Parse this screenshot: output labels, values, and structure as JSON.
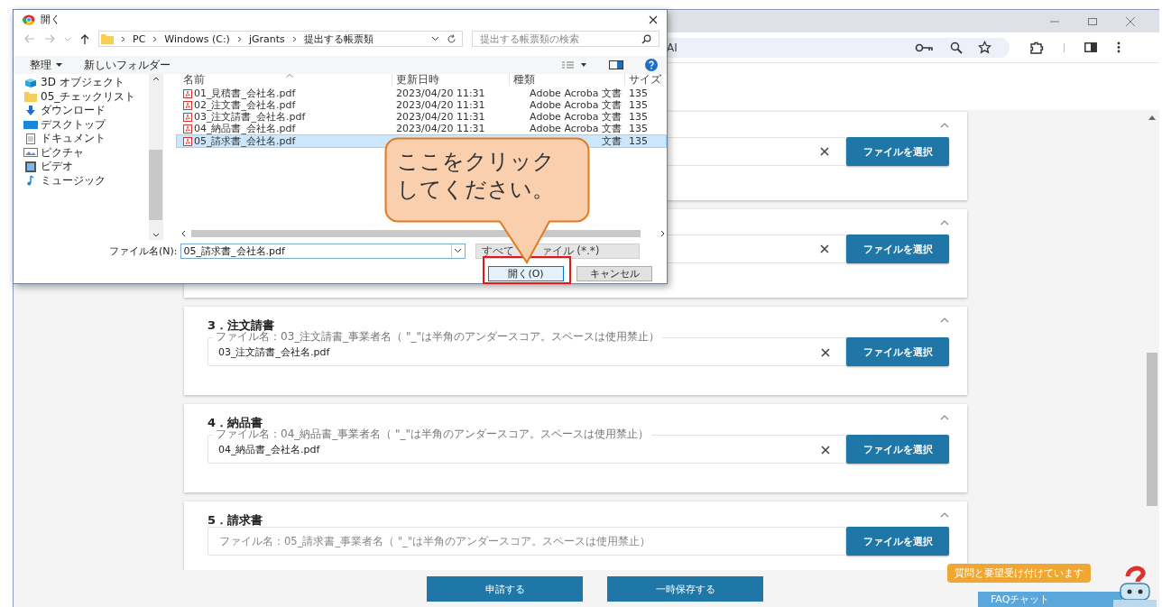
{
  "browser": {
    "address_text": "AI"
  },
  "cards": [
    {
      "expanded": true,
      "filled": true,
      "button": "ファイルを選択"
    },
    {
      "expanded": true,
      "filled": true,
      "button": "ファイルを選択"
    },
    {
      "title": "3．注文請書",
      "expanded": true,
      "filled": true,
      "legend": "ファイル名：03_注文請書_事業者名（ \"_\"は半角のアンダースコア。スペースは使用禁止）",
      "value": "03_注文請書_会社名.pdf",
      "button": "ファイルを選択"
    },
    {
      "title": "4．納品書",
      "expanded": true,
      "filled": true,
      "legend": "ファイル名：04_納品書_事業者名（ \"_\"は半角のアンダースコア。スペースは使用禁止）",
      "value": "04_納品書_会社名.pdf",
      "button": "ファイルを選択"
    },
    {
      "title": "5．請求書",
      "expanded": true,
      "filled": false,
      "placeholder": "ファイル名：05_請求書_事業者名（ \"_\"は半角のアンダースコア。スペースは使用禁止）",
      "button": "ファイルを選択"
    }
  ],
  "footer_buttons": [
    "申請する",
    "一時保存する"
  ],
  "faq": {
    "tooltip": "質問と要望受け付けています",
    "label": "FAQチャット"
  },
  "dialog": {
    "title": "開く",
    "breadcrumb": [
      "PC",
      "Windows (C:)",
      "jGrants",
      "提出する帳票類"
    ],
    "search": {
      "placeholder": "提出する帳票類の検索"
    },
    "commands": [
      "整理",
      "新しいフォルダー"
    ],
    "tree": [
      {
        "label": "3D オブジェクト",
        "kind": "cube"
      },
      {
        "label": "05_チェックリスト",
        "kind": "folder"
      },
      {
        "label": "ダウンロード",
        "kind": "download"
      },
      {
        "label": "デスクトップ",
        "kind": "desktop"
      },
      {
        "label": "ドキュメント",
        "kind": "document"
      },
      {
        "label": "ピクチャ",
        "kind": "picture"
      },
      {
        "label": "ビデオ",
        "kind": "video"
      },
      {
        "label": "ミュージック",
        "kind": "music"
      }
    ],
    "columns": [
      "名前",
      "更新日時",
      "種類",
      "サイズ"
    ],
    "files": [
      {
        "name": "01_見積書_会社名.pdf",
        "modified": "2023/04/20 11:31",
        "type": "Adobe Acroba 文書",
        "size": "135",
        "selected": false
      },
      {
        "name": "02_注文書_会社名.pdf",
        "modified": "2023/04/20 11:31",
        "type": "Adobe Acroba 文書",
        "size": "135",
        "selected": false
      },
      {
        "name": "03_注文請書_会社名.pdf",
        "modified": "2023/04/20 11:31",
        "type": "Adobe Acroba 文書",
        "size": "135",
        "selected": false
      },
      {
        "name": "04_納品書_会社名.pdf",
        "modified": "2023/04/20 11:31",
        "type": "Adobe Acroba 文書",
        "size": "135",
        "selected": false
      },
      {
        "name": "05_請求書_会社名.pdf",
        "type": "文書",
        "size": "135",
        "selected": true
      }
    ],
    "filename_label": "ファイル名(N):",
    "filename": {
      "value": "05_請求書_会社名.pdf"
    },
    "filter": [
      "すべて",
      "ァイル (*.*)"
    ],
    "buttons": [
      {
        "label": "開く(O)",
        "primary": true
      },
      {
        "label": "キャンセル",
        "primary": false
      }
    ]
  },
  "callout": {
    "lines": [
      "ここをクリック",
      "してください。"
    ]
  }
}
